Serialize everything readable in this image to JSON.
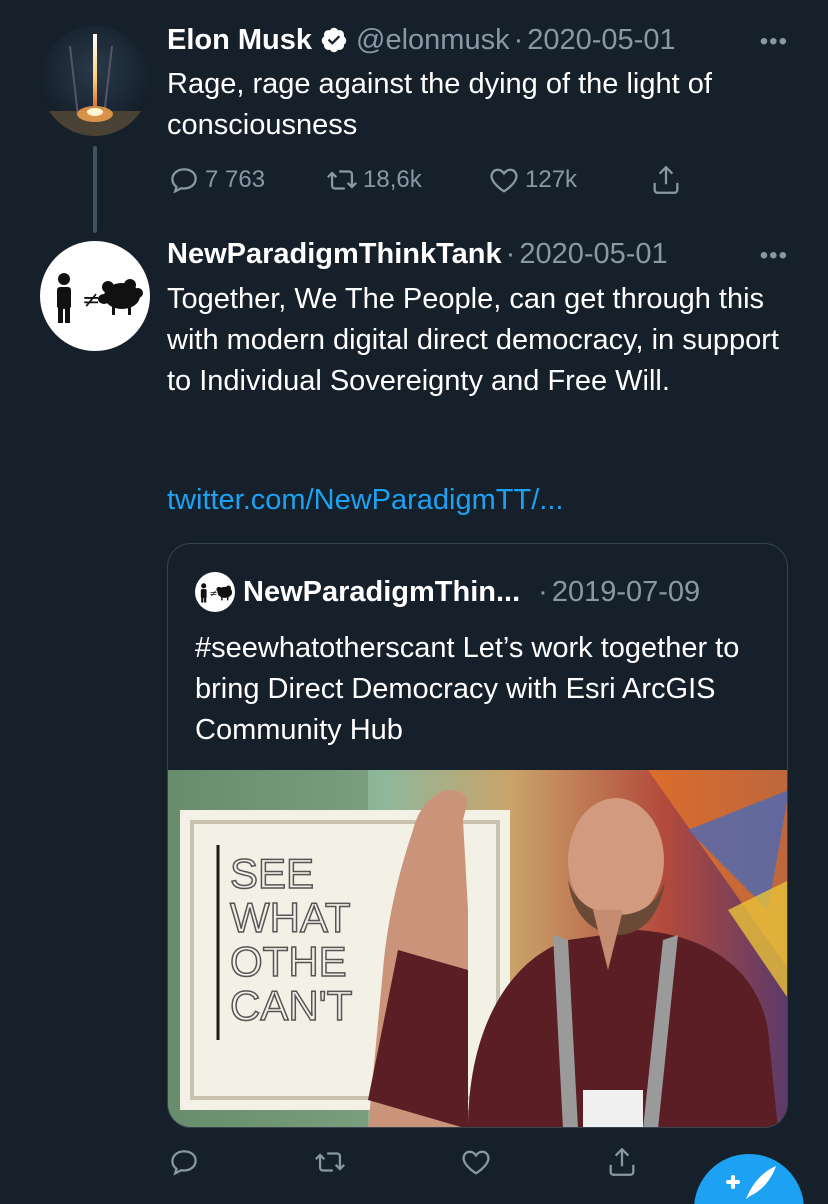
{
  "tweet1": {
    "name": "Elon Musk",
    "handle": "@elonmusk",
    "separator": "·",
    "date": "2020-05-01",
    "more": "•••",
    "text": "Rage, rage against the dying of the light of consciousness",
    "actions": {
      "reply_count": "7 763",
      "retweet_count": "18,6k",
      "like_count": "127k"
    }
  },
  "tweet2": {
    "name": "NewParadigmThinkTank",
    "separator": "·",
    "date": "2020-05-01",
    "more": "•••",
    "text": "Together, We The People, can get through this with modern digital direct democracy, in support to Individual Sovereignty and Free Will.",
    "link": "twitter.com/NewParadigmTT/...",
    "avatar_symbol": "≠",
    "quote": {
      "name": "NewParadigmThin...",
      "separator": "·",
      "date": "2019-07-09",
      "text": "#seewhatotherscant Let’s work together to bring Direct Democracy with Esri ArcGIS Community Hub",
      "image_sign": [
        "SEE",
        "WHAT",
        "OTHE",
        "CAN'T"
      ]
    }
  },
  "colors": {
    "background": "#15202b",
    "secondary_text": "#8899a6",
    "link": "#1da1f2",
    "border": "#38444d"
  }
}
